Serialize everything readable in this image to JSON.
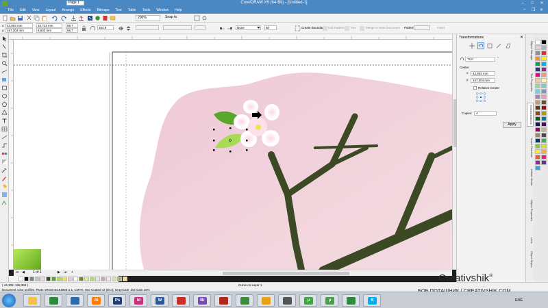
{
  "window": {
    "title": "CorelDRAW X6 (64-Bit) - [Untitled-1]"
  },
  "menu": {
    "items": [
      "File",
      "Edit",
      "View",
      "Layout",
      "Arrange",
      "Effects",
      "Bitmaps",
      "Text",
      "Table",
      "Tools",
      "Window",
      "Help"
    ]
  },
  "standard_toolbar": {
    "zoom_level": "200%",
    "snap_to_label": "Snap to",
    "launch_label": ""
  },
  "property_bar": {
    "x": "43,903 mm",
    "y": "167,304 mm",
    "width": "10,714 mm",
    "height": "8,633 mm",
    "scale_x": "66,7",
    "scale_y": "66,7",
    "angle": "354,9",
    "outline": "None",
    "opacity": "50",
    "create_label": "Create Boundary",
    "edit_label": "Edit Pattern",
    "trim_label": "Trim",
    "intersect_label": "Merge to New Document",
    "pstyle_label": "Pattern:",
    "print_label": "Insert"
  },
  "transformations": {
    "title": "Transformations",
    "angle": "72,0",
    "angle_unit": "°",
    "center_label": "Center",
    "center_x": "43,903 mm",
    "center_y": "167,304 mm",
    "relative_center_label": "Relative Center",
    "copies_label": "Copies:",
    "copies": "4",
    "apply_label": "Apply"
  },
  "docker_tabs": [
    "Object Manager",
    "Text Properties",
    "Transformations",
    "Insert Character",
    "Artistic Media",
    "Object Properties",
    "Lens",
    "Object Styles"
  ],
  "page_nav": {
    "position": "1 of 1",
    "page_tab": "Page 1"
  },
  "status": {
    "cursor": "( 44,305; 168,369 )",
    "object_info": "Curve on Layer 1",
    "color_profile": "Document color profiles: RGB: sRGB IEC61966-2.1; CMYK: ISO Coated v2 (ECI); Grayscale: Dot Gain 15%"
  },
  "watermark": {
    "brand": "Creativshik",
    "mark": "®",
    "tagline": "БОБ ПОТАШНИК / CREATIVSHIK.COM"
  },
  "colors": {
    "titlebar": "#4a88c4",
    "background_pink": "#f1d4dc",
    "branch": "#3b4a24",
    "leaf_dark": "#58a62b",
    "leaf_light": "#a8d957",
    "flower_center": "#f2e25a"
  },
  "palette": [
    "#ffffff",
    "#000000",
    "#d7d7d7",
    "#b3b3b3",
    "#8e8e8e",
    "#e8232b",
    "#f7941d",
    "#fff200",
    "#00a651",
    "#00aeef",
    "#2e3192",
    "#92278f",
    "#ec008c",
    "#f69679",
    "#fdc689",
    "#fff799",
    "#a3d39c",
    "#7accc8",
    "#6dcff6",
    "#8393ca",
    "#a186be",
    "#f49ac2",
    "#c69c6d",
    "#754c24",
    "#603913",
    "#9e0b0f",
    "#a0410d",
    "#aba000",
    "#005e20",
    "#0076a3",
    "#1b1464",
    "#440e62",
    "#9e005d",
    "#c7b299",
    "#998675",
    "#534741",
    "#003663",
    "#39b54a",
    "#8dc63f",
    "#d9e021",
    "#fcee21",
    "#fbb03b",
    "#f15a24",
    "#ed1e79",
    "#93278f",
    "#662d91",
    "#29abe2"
  ],
  "doc_palette": [
    "#ffffff",
    "#000000",
    "#7f7f7f",
    "#c0c0c0",
    "#f1d4dc",
    "#3b4a24",
    "#58a62b",
    "#a8d957",
    "#f2e25a",
    "#e8c9d1",
    "#ffffff",
    "#6e8c2b",
    "#d6eaa3",
    "#b2d870",
    "#e6e6e6",
    "#c9a6b0",
    "#f6e9ed",
    "#dfe1a0",
    "#a3b878",
    "#efe38f"
  ],
  "taskbar": {
    "apps": [
      {
        "name": "start",
        "label": ""
      },
      {
        "name": "explorer",
        "label": ""
      },
      {
        "name": "chrome",
        "label": ""
      },
      {
        "name": "media",
        "label": ""
      },
      {
        "name": "illustrator",
        "label": "Ai"
      },
      {
        "name": "photoshop",
        "label": "Ps"
      },
      {
        "name": "indesign",
        "label": "Id"
      },
      {
        "name": "word",
        "label": "W"
      },
      {
        "name": "pdf",
        "label": ""
      },
      {
        "name": "bridge",
        "label": "Br"
      },
      {
        "name": "acrobat",
        "label": ""
      },
      {
        "name": "coreldraw",
        "label": ""
      },
      {
        "name": "archive",
        "label": ""
      },
      {
        "name": "network",
        "label": ""
      },
      {
        "name": "torrent",
        "label": "µ"
      },
      {
        "name": "torrent2",
        "label": "µ"
      },
      {
        "name": "chrome2",
        "label": ""
      },
      {
        "name": "skype",
        "label": "S"
      }
    ],
    "time": "ENG"
  }
}
